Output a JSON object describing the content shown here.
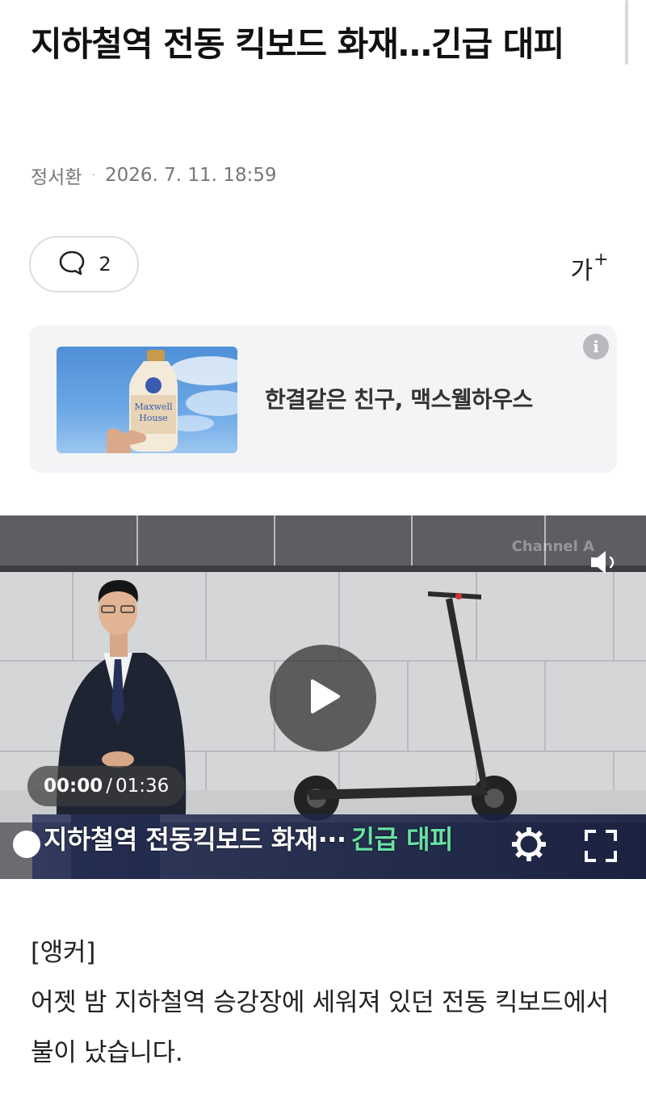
{
  "article": {
    "title": "지하철역 전동 킥보드 화재…긴급 대피",
    "author": "정서환",
    "separator": "·",
    "datetime": "2026. 7. 11. 18:59",
    "comment_count": "2",
    "font_size_label": "가",
    "font_size_plus": "+"
  },
  "ad": {
    "text": "한결같은 친구, 맥스웰하우스",
    "info_icon_label": "i",
    "product_label_line1": "Maxwell",
    "product_label_line2": "House"
  },
  "video": {
    "watermark": "Channel A",
    "current_time": "00:00",
    "time_separator": "/",
    "duration": "01:36",
    "progress": 0,
    "caption_main": "지하철역 전동킥보드 화재···",
    "caption_highlight": "긴급 대피"
  },
  "body": {
    "paragraph1": "[앵커]",
    "paragraph2": "어젯 밤 지하철역 승강장에 세워져 있던 전동 킥보드에서 불이 났습니다."
  },
  "icons": {
    "comment": "comment-bubble-icon",
    "info": "info-icon",
    "mute": "speaker-muted-icon",
    "play": "play-icon",
    "settings": "gear-icon",
    "fullscreen": "fullscreen-icon"
  },
  "colors": {
    "caption_highlight": "#68e0a6",
    "ad_background": "#f3f4f6",
    "meta_text": "#777777"
  }
}
